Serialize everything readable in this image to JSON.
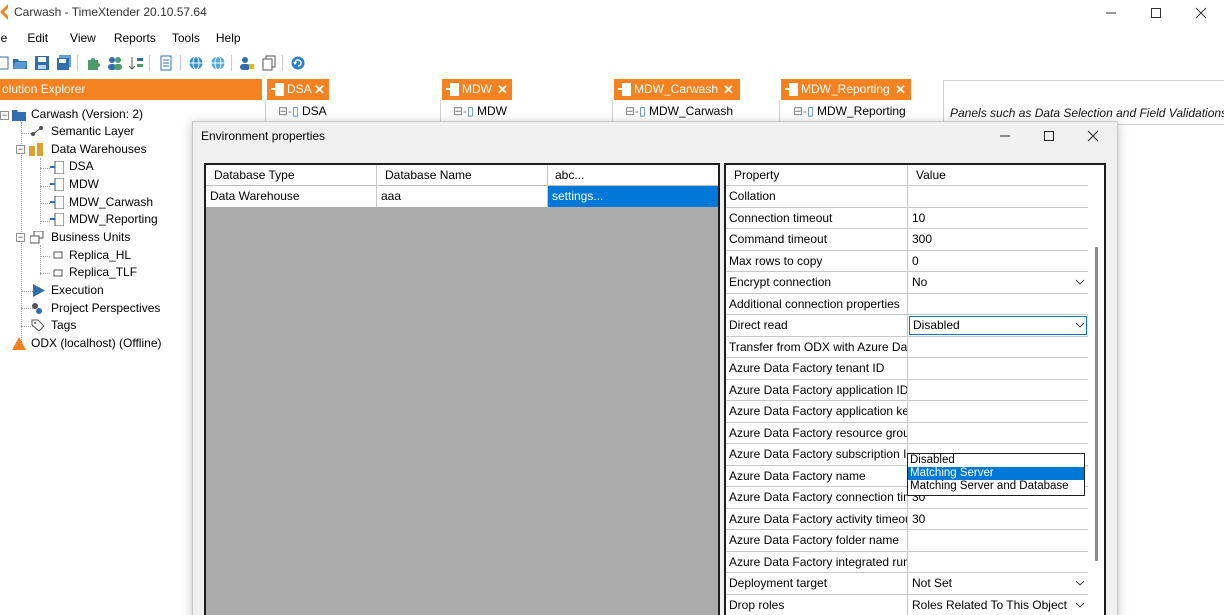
{
  "window": {
    "title": "Carwash - TimeXtender 20.10.57.64"
  },
  "menu": [
    "le",
    "Edit",
    "View",
    "Reports",
    "Tools",
    "Help"
  ],
  "solution_explorer": {
    "title": "olution Explorer",
    "project": "Carwash (Version: 2)",
    "semantic_layer": "Semantic Layer",
    "data_warehouses": "Data Warehouses",
    "warehouses": [
      "DSA",
      "MDW",
      "MDW_Carwash",
      "MDW_Reporting"
    ],
    "business_units": "Business Units",
    "replicas": [
      "Replica_HL",
      "Replica_TLF"
    ],
    "execution": "Execution",
    "perspectives": "Project Perspectives",
    "tags": "Tags",
    "odx": "ODX (localhost) (Offline)"
  },
  "tabs": [
    {
      "label": "DSA",
      "node": "DSA"
    },
    {
      "label": "MDW",
      "node": "MDW"
    },
    {
      "label": "MDW_Carwash",
      "node": "MDW_Carwash"
    },
    {
      "label": "MDW_Reporting",
      "node": "MDW_Reporting"
    }
  ],
  "help_pane": {
    "text": "Panels such as Data Selection and Field Validations are"
  },
  "dialog": {
    "title": "Environment properties",
    "grid": {
      "columns": [
        "Database Type",
        "Database Name",
        "abc..."
      ],
      "rows": [
        {
          "type": "Data Warehouse",
          "name": "aaa",
          "extra": "settings..."
        }
      ]
    },
    "props_header": {
      "property": "Property",
      "value": "Value"
    },
    "properties": [
      {
        "name": "Collation",
        "value": ""
      },
      {
        "name": "Connection timeout",
        "value": "10"
      },
      {
        "name": "Command timeout",
        "value": "300"
      },
      {
        "name": "Max rows to copy",
        "value": "0"
      },
      {
        "name": "Encrypt connection",
        "value": "No"
      },
      {
        "name": "Additional connection properties",
        "value": ""
      },
      {
        "name": "Direct read",
        "value": "Disabled"
      },
      {
        "name": "Transfer from ODX with Azure Data...",
        "value": ""
      },
      {
        "name": "Azure Data Factory tenant ID",
        "value": ""
      },
      {
        "name": "Azure Data Factory application ID",
        "value": ""
      },
      {
        "name": "Azure Data Factory application key",
        "value": ""
      },
      {
        "name": "Azure Data Factory resource group",
        "value": ""
      },
      {
        "name": "Azure Data Factory subscription ID",
        "value": ""
      },
      {
        "name": "Azure Data Factory name",
        "value": ""
      },
      {
        "name": "Azure Data Factory connection tim...",
        "value": "30"
      },
      {
        "name": "Azure Data Factory activity timeout ...",
        "value": "30"
      },
      {
        "name": "Azure Data Factory folder name",
        "value": ""
      },
      {
        "name": "Azure Data Factory integrated runti...",
        "value": ""
      },
      {
        "name": "Deployment target",
        "value": "Not Set"
      },
      {
        "name": "Drop roles",
        "value": "Roles Related To This Object"
      }
    ],
    "direct_read_options": [
      "Disabled",
      "Matching Server",
      "Matching Server and Database"
    ]
  },
  "colors": {
    "accent": "#f58220",
    "selection": "#0078d7"
  }
}
